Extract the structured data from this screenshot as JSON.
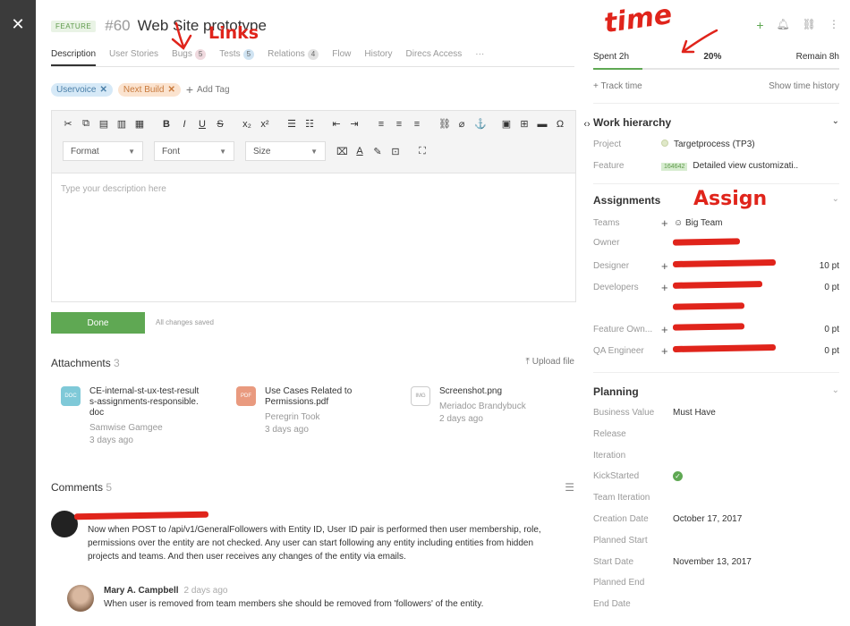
{
  "header": {
    "type_badge": "FEATURE",
    "id": "#60",
    "title": "Web Site prototype"
  },
  "annotations": {
    "links": "Links",
    "time": "time",
    "assign": "Assign"
  },
  "tabs": [
    {
      "label": "Description",
      "count": ""
    },
    {
      "label": "User Stories",
      "count": ""
    },
    {
      "label": "Bugs",
      "count": "5"
    },
    {
      "label": "Tests",
      "count": "5"
    },
    {
      "label": "Relations",
      "count": "4"
    },
    {
      "label": "Flow",
      "count": ""
    },
    {
      "label": "History",
      "count": ""
    },
    {
      "label": "Direcs Access",
      "count": ""
    },
    {
      "label": "···",
      "count": ""
    }
  ],
  "tags": [
    {
      "label": "Uservoice"
    },
    {
      "label": "Next Build"
    }
  ],
  "add_tag_label": "Add Tag",
  "editor": {
    "format_label": "Format",
    "font_label": "Font",
    "size_label": "Size",
    "placeholder": "Type your description here"
  },
  "done_label": "Done",
  "saved_note": "All changes saved",
  "attachments": {
    "title": "Attachments",
    "count": "3",
    "upload_label": "Upload file",
    "items": [
      {
        "type": "DOC",
        "color": "#7fc9d8",
        "name": "CE-internal-st-ux-test-results-assignments-responsible.doc",
        "author": "Samwise Gamgee",
        "ago": "3 days ago"
      },
      {
        "type": "PDF",
        "color": "#e99a7f",
        "name": "Use Cases Related to Permissions.pdf",
        "author": "Peregrin Took",
        "ago": "3 days ago"
      },
      {
        "type": "IMG",
        "color": "#ffffff",
        "name": "Screenshot.png",
        "author": "Meriadoc Brandybuck",
        "ago": "2 days ago"
      }
    ]
  },
  "comments": {
    "title": "Comments",
    "count": "5",
    "items": [
      {
        "author": "",
        "ago": "",
        "text": "Now when POST to /api/v1/GeneralFollowers with Entity ID, User ID pair is performed then user membership, role, permissions over the entity are not checked. Any user can start following any entity including entities from hidden projects and teams. And then user receives any changes of the entity via emails."
      },
      {
        "author": "Mary A. Campbell",
        "ago": "2 days ago",
        "text": "When user is removed from team members she should be removed from 'followers' of the entity."
      }
    ]
  },
  "time": {
    "spent": "Spent 2h",
    "percent": "20%",
    "progress": 0.2,
    "remain": "Remain 8h",
    "track_label": "Track time",
    "history_label": "Show time history"
  },
  "work_hierarchy": {
    "title": "Work hierarchy",
    "project_label": "Project",
    "project_value": "Targetprocess (TP3)",
    "feature_label": "Feature",
    "feature_id": "164642",
    "feature_value": "Detailed view customizati.."
  },
  "assignments": {
    "title": "Assignments",
    "rows": [
      {
        "role": "Teams",
        "value": "Big Team",
        "pt": ""
      },
      {
        "role": "Owner",
        "value": "",
        "pt": ""
      },
      {
        "role": "Designer",
        "value": "",
        "pt": "10 pt"
      },
      {
        "role": "Developers",
        "value": "",
        "pt": "0 pt"
      },
      {
        "role": "Feature Own...",
        "value": "",
        "pt": "0 pt"
      },
      {
        "role": "QA Engineer",
        "value": "",
        "pt": "0 pt"
      }
    ]
  },
  "planning": {
    "title": "Planning",
    "rows": [
      {
        "label": "Business Value",
        "value": "Must Have"
      },
      {
        "label": "Release",
        "value": ""
      },
      {
        "label": "Iteration",
        "value": ""
      },
      {
        "label": "KickStarted",
        "value": ""
      },
      {
        "label": "Team Iteration",
        "value": ""
      },
      {
        "label": "Creation Date",
        "value": "October 17, 2017"
      },
      {
        "label": "Planned Start",
        "value": ""
      },
      {
        "label": "Start Date",
        "value": "November 13, 2017"
      },
      {
        "label": "Planned End",
        "value": ""
      },
      {
        "label": "End Date",
        "value": ""
      }
    ]
  }
}
